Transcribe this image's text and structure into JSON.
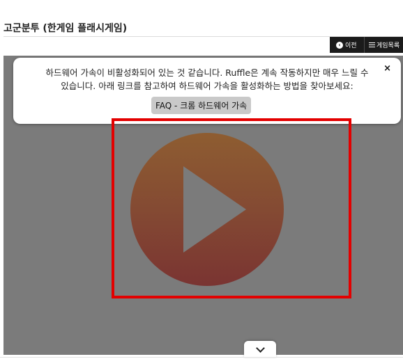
{
  "page": {
    "title": "고군분투 (한게임 플래시게임)"
  },
  "nav": {
    "prev_label": "이전",
    "list_label": "게임목록"
  },
  "notice": {
    "message": "하드웨어 가속이 비활성화되어 있는 것 같습니다. Ruffle은 계속 작동하지만 매우 느릴 수 있습니다. 아래 링크를 참고하여 하드웨어 가속을 활성화하는 방법을 찾아보세요:",
    "close_label": "×",
    "faq_label": "FAQ - 크롬 하드웨어 가속"
  },
  "icons": {
    "prev": "chevron-left-circle-icon",
    "list": "list-icon",
    "play": "play-icon",
    "expand": "chevron-down-icon"
  },
  "colors": {
    "game_background": "#7b7b7b",
    "highlight_border": "#e30000",
    "play_top": "#8e5d31",
    "play_bottom": "#7a3432",
    "nav_bar": "#1b1b1b"
  }
}
